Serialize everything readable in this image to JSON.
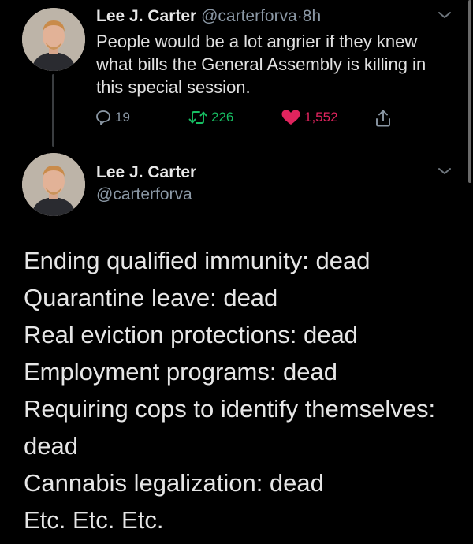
{
  "tweet_reply": {
    "name": "Lee J. Carter",
    "handle": "@carterforva",
    "separator": "·",
    "time": "8h",
    "text": "People would be a lot angrier if they knew what bills the General Assembly is killing in this special session.",
    "replies": "19",
    "retweets": "226",
    "likes": "1,552",
    "icons": [
      "reply-icon",
      "retweet-icon",
      "heart-icon",
      "share-icon",
      "chevron-down-icon"
    ]
  },
  "tweet_main": {
    "name": "Lee J. Carter",
    "handle": "@carterforva",
    "lines": [
      "Ending qualified immunity: dead",
      "Quarantine leave: dead",
      "Real eviction protections: dead",
      "Employment programs: dead",
      "Requiring cops to identify themselves:",
      "dead",
      "Cannabis legalization: dead",
      "Etc. Etc. Etc."
    ]
  },
  "colors": {
    "background": "#000000",
    "retweet_green": "#17bf63",
    "like_red": "#e0245e",
    "secondary_gray": "#8b98a5"
  }
}
